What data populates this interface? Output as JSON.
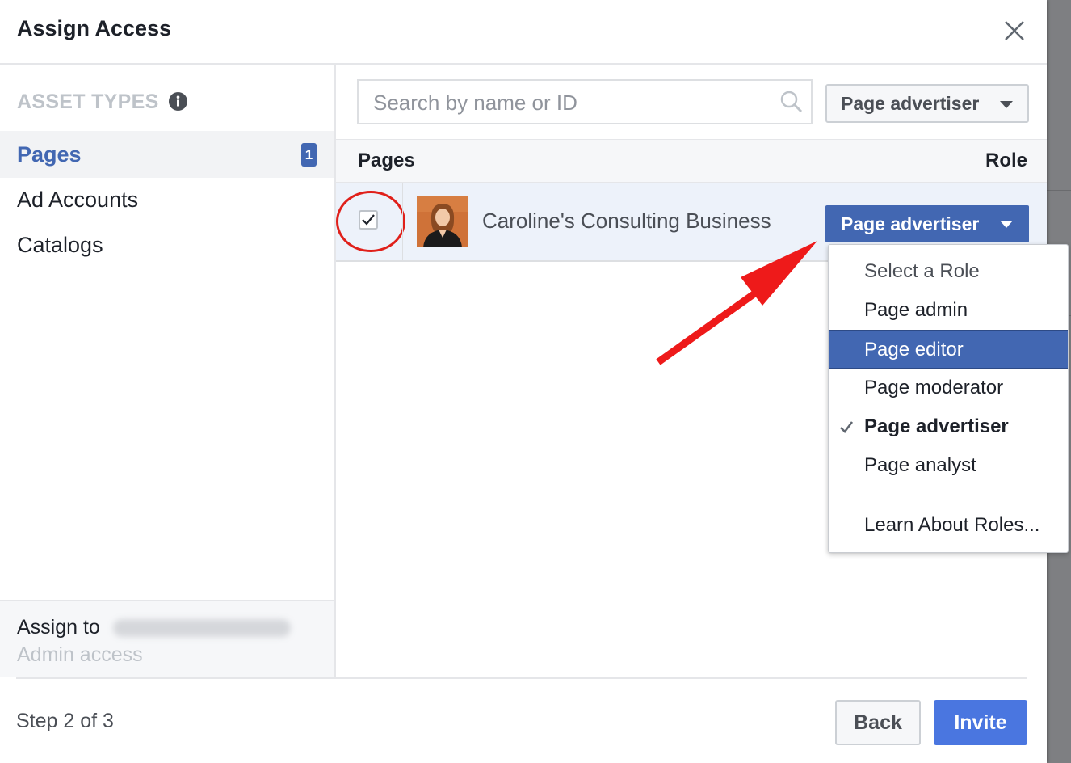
{
  "dialog": {
    "title": "Assign Access"
  },
  "sidebar": {
    "heading": "ASSET TYPES",
    "items": [
      {
        "label": "Pages",
        "badge": "1",
        "active": true
      },
      {
        "label": "Ad Accounts"
      },
      {
        "label": "Catalogs"
      }
    ],
    "assign_label": "Assign to",
    "access_label": "Admin access"
  },
  "main": {
    "search_placeholder": "Search by name or ID",
    "filter_label": "Page advertiser",
    "col_pages": "Pages",
    "col_role": "Role",
    "rows": [
      {
        "name": "Caroline's Consulting Business",
        "role": "Page advertiser",
        "checked": true
      }
    ]
  },
  "role_menu": {
    "items": [
      {
        "label": "Select a Role"
      },
      {
        "label": "Page admin"
      },
      {
        "label": "Page editor",
        "highlighted": true
      },
      {
        "label": "Page moderator"
      },
      {
        "label": "Page advertiser",
        "selected": true
      },
      {
        "label": "Page analyst"
      }
    ],
    "learn_label": "Learn About Roles..."
  },
  "footer": {
    "step": "Step 2 of 3",
    "back": "Back",
    "invite": "Invite"
  },
  "colors": {
    "brand": "#4267b2",
    "invite": "#4a76e0",
    "annotation": "#e0201a"
  }
}
